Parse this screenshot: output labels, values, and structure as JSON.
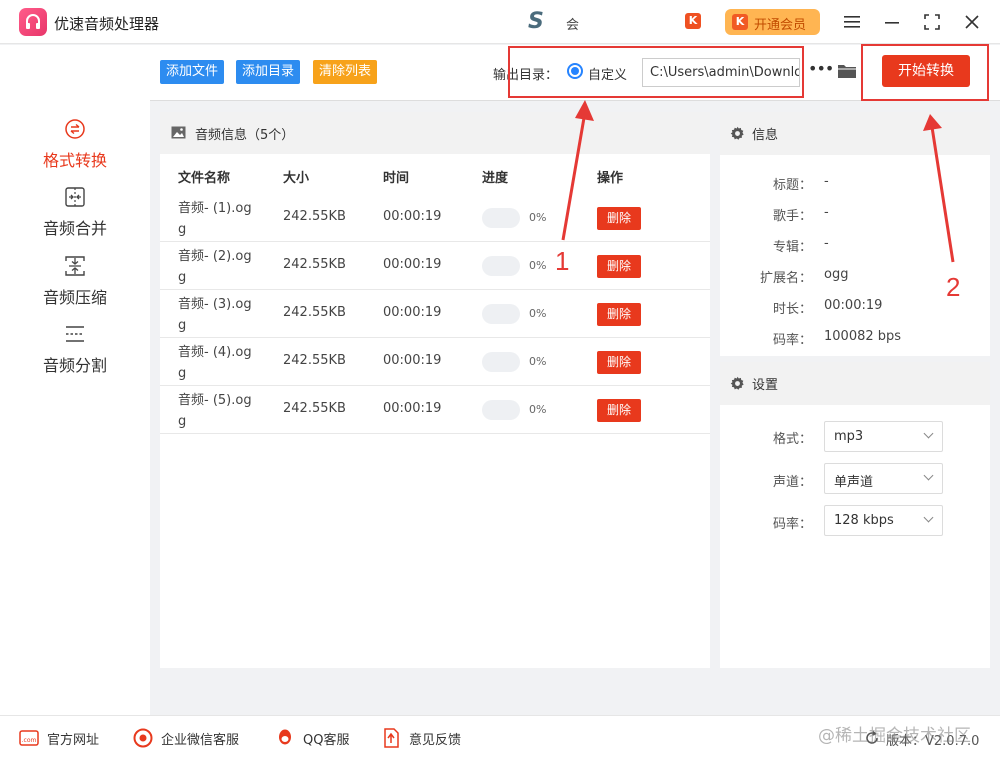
{
  "app": {
    "title": "优速音频处理器",
    "user_name": "会",
    "vip_label": "开通会员"
  },
  "sidebar": {
    "items": [
      {
        "label": "格式转换",
        "active": true
      },
      {
        "label": "音频合并",
        "active": false
      },
      {
        "label": "音频压缩",
        "active": false
      },
      {
        "label": "音频分割",
        "active": false
      }
    ]
  },
  "toolbar": {
    "add_file": "添加文件",
    "add_dir": "添加目录",
    "clear_list": "清除列表",
    "output_label": "输出目录：",
    "custom_label": "自定义",
    "output_path": "C:\\Users\\admin\\Downloads",
    "start": "开始转换"
  },
  "file_panel": {
    "title": "音频信息（5个）",
    "columns": [
      "文件名称",
      "大小",
      "时间",
      "进度",
      "操作"
    ],
    "rows": [
      {
        "name": "音频- (1).ogg",
        "size": "242.55KB",
        "time": "00:00:19",
        "progress": "0%",
        "action": "删除"
      },
      {
        "name": "音频- (2).ogg",
        "size": "242.55KB",
        "time": "00:00:19",
        "progress": "0%",
        "action": "删除"
      },
      {
        "name": "音频- (3).ogg",
        "size": "242.55KB",
        "time": "00:00:19",
        "progress": "0%",
        "action": "删除"
      },
      {
        "name": "音频- (4).ogg",
        "size": "242.55KB",
        "time": "00:00:19",
        "progress": "0%",
        "action": "删除"
      },
      {
        "name": "音频- (5).ogg",
        "size": "242.55KB",
        "time": "00:00:19",
        "progress": "0%",
        "action": "删除"
      }
    ]
  },
  "info": {
    "title": "信息",
    "fields": [
      {
        "k": "标题：",
        "v": "-"
      },
      {
        "k": "歌手：",
        "v": "-"
      },
      {
        "k": "专辑：",
        "v": "-"
      },
      {
        "k": "扩展名：",
        "v": "ogg"
      },
      {
        "k": "时长：",
        "v": "00:00:19"
      },
      {
        "k": "码率：",
        "v": "100082 bps"
      }
    ]
  },
  "settings": {
    "title": "设置",
    "format": {
      "label": "格式：",
      "value": "mp3"
    },
    "channel": {
      "label": "声道：",
      "value": "单声道"
    },
    "bitrate": {
      "label": "码率：",
      "value": "128 kbps"
    }
  },
  "annotations": [
    "1",
    "2"
  ],
  "footer": {
    "website": "官方网址",
    "wechat": "企业微信客服",
    "qq": "QQ客服",
    "feedback": "意见反馈",
    "watermark": "@稀土掘金技术社区",
    "version": "版本：V2.0.7.0"
  },
  "colors": {
    "accent": "#e8391d",
    "blue_btn": "#2d8cf0",
    "orange_btn": "#f7a21a",
    "vip": "#ffb552",
    "callout": "#e53935"
  }
}
